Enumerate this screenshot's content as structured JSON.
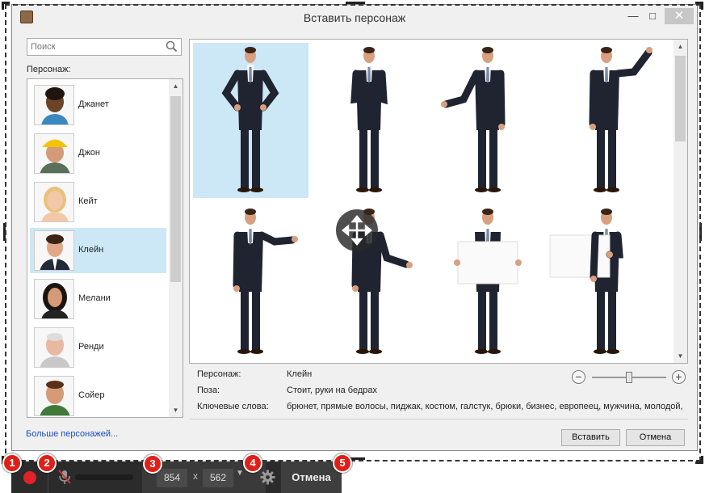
{
  "window": {
    "title": "Вставить персонаж"
  },
  "sidebar": {
    "search_placeholder": "Поиск",
    "character_label": "Персонаж:",
    "characters": [
      {
        "name": "Джанет",
        "selected": false
      },
      {
        "name": "Джон",
        "selected": false
      },
      {
        "name": "Кейт",
        "selected": false
      },
      {
        "name": "Клейн",
        "selected": true
      },
      {
        "name": "Мелани",
        "selected": false
      },
      {
        "name": "Ренди",
        "selected": false
      },
      {
        "name": "Сойер",
        "selected": false
      }
    ],
    "more_link": "Больше персонажей..."
  },
  "info": {
    "character_key": "Персонаж:",
    "character_value": "Клейн",
    "pose_key": "Поза:",
    "pose_value": "Стоит, руки на бедрах",
    "keywords_key": "Ключевые слова:",
    "keywords_value": "брюнет, прямые волосы, пиджак,  костюм, галстук, брюки, бизнес, европеец, мужчина, молодой,"
  },
  "zoom": {
    "minus": "−",
    "plus": "+",
    "level": 0.5
  },
  "buttons": {
    "insert": "Вставить",
    "cancel": "Отмена"
  },
  "recorder": {
    "width": "854",
    "x": "x",
    "height": "562",
    "cancel": "Отмена"
  },
  "badges": [
    "1",
    "2",
    "3",
    "4",
    "5"
  ],
  "colors": {
    "selection": "#cce8f7",
    "record": "#e3212a",
    "badge": "#e02018",
    "link": "#1a4fc0"
  }
}
